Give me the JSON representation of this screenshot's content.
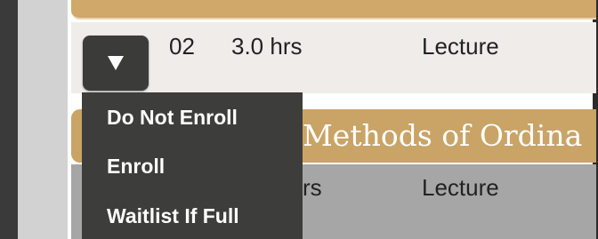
{
  "course_row": {
    "section": "02",
    "hours": "3.0 hrs",
    "type": "Lecture",
    "enroll_dropdown": {
      "icon": "triangle-down-icon",
      "options": [
        "Do Not Enroll",
        "Enroll",
        "Waitlist If Full"
      ]
    }
  },
  "next_course": {
    "title": "Methods of Ordina",
    "hours_fragment": "rs",
    "type": "Lecture"
  },
  "colors": {
    "gold": "#c9a466",
    "menu_bg": "#3d3d3b",
    "menu_text": "#ffffff",
    "title_text": "#ffffff"
  }
}
